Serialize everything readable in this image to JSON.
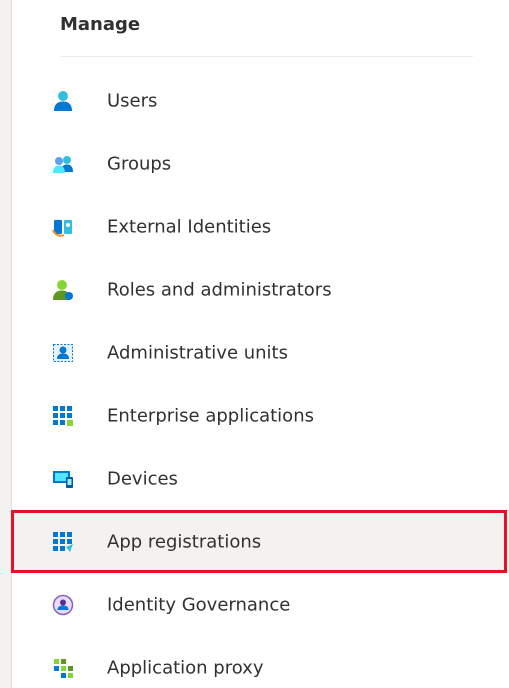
{
  "section": {
    "title": "Manage"
  },
  "nav": {
    "items": [
      {
        "label": "Users",
        "icon": "user-icon"
      },
      {
        "label": "Groups",
        "icon": "groups-icon"
      },
      {
        "label": "External Identities",
        "icon": "external-identities-icon"
      },
      {
        "label": "Roles and administrators",
        "icon": "roles-icon"
      },
      {
        "label": "Administrative units",
        "icon": "admin-units-icon"
      },
      {
        "label": "Enterprise applications",
        "icon": "enterprise-apps-icon"
      },
      {
        "label": "Devices",
        "icon": "devices-icon"
      },
      {
        "label": "App registrations",
        "icon": "app-registrations-icon",
        "selected": true
      },
      {
        "label": "Identity Governance",
        "icon": "identity-governance-icon"
      },
      {
        "label": "Application proxy",
        "icon": "application-proxy-icon"
      }
    ]
  },
  "colors": {
    "primary": "#0078d4",
    "highlight_border": "#e81123",
    "selected_bg": "#f3f2f1",
    "text": "#323130"
  }
}
